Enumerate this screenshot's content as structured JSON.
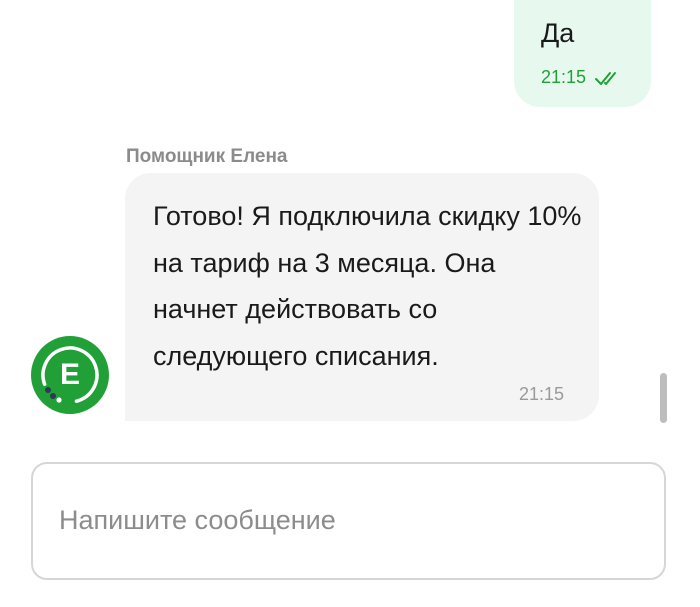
{
  "outgoing_message": {
    "text": "Да",
    "time": "21:15",
    "status_icon": "double-check-icon"
  },
  "incoming_message": {
    "sender": "Помощник Елена",
    "text": "Готово! Я подключила скидку 10% на тариф на 3 месяца. Она начнет действовать со следующего списания.",
    "time": "21:15",
    "avatar_letter": "Е"
  },
  "composer": {
    "placeholder": "Напишите сообщение",
    "value": ""
  },
  "colors": {
    "accent_green": "#21a038",
    "outgoing_bg": "#e7f9ee",
    "incoming_bg": "#f4f4f4"
  }
}
